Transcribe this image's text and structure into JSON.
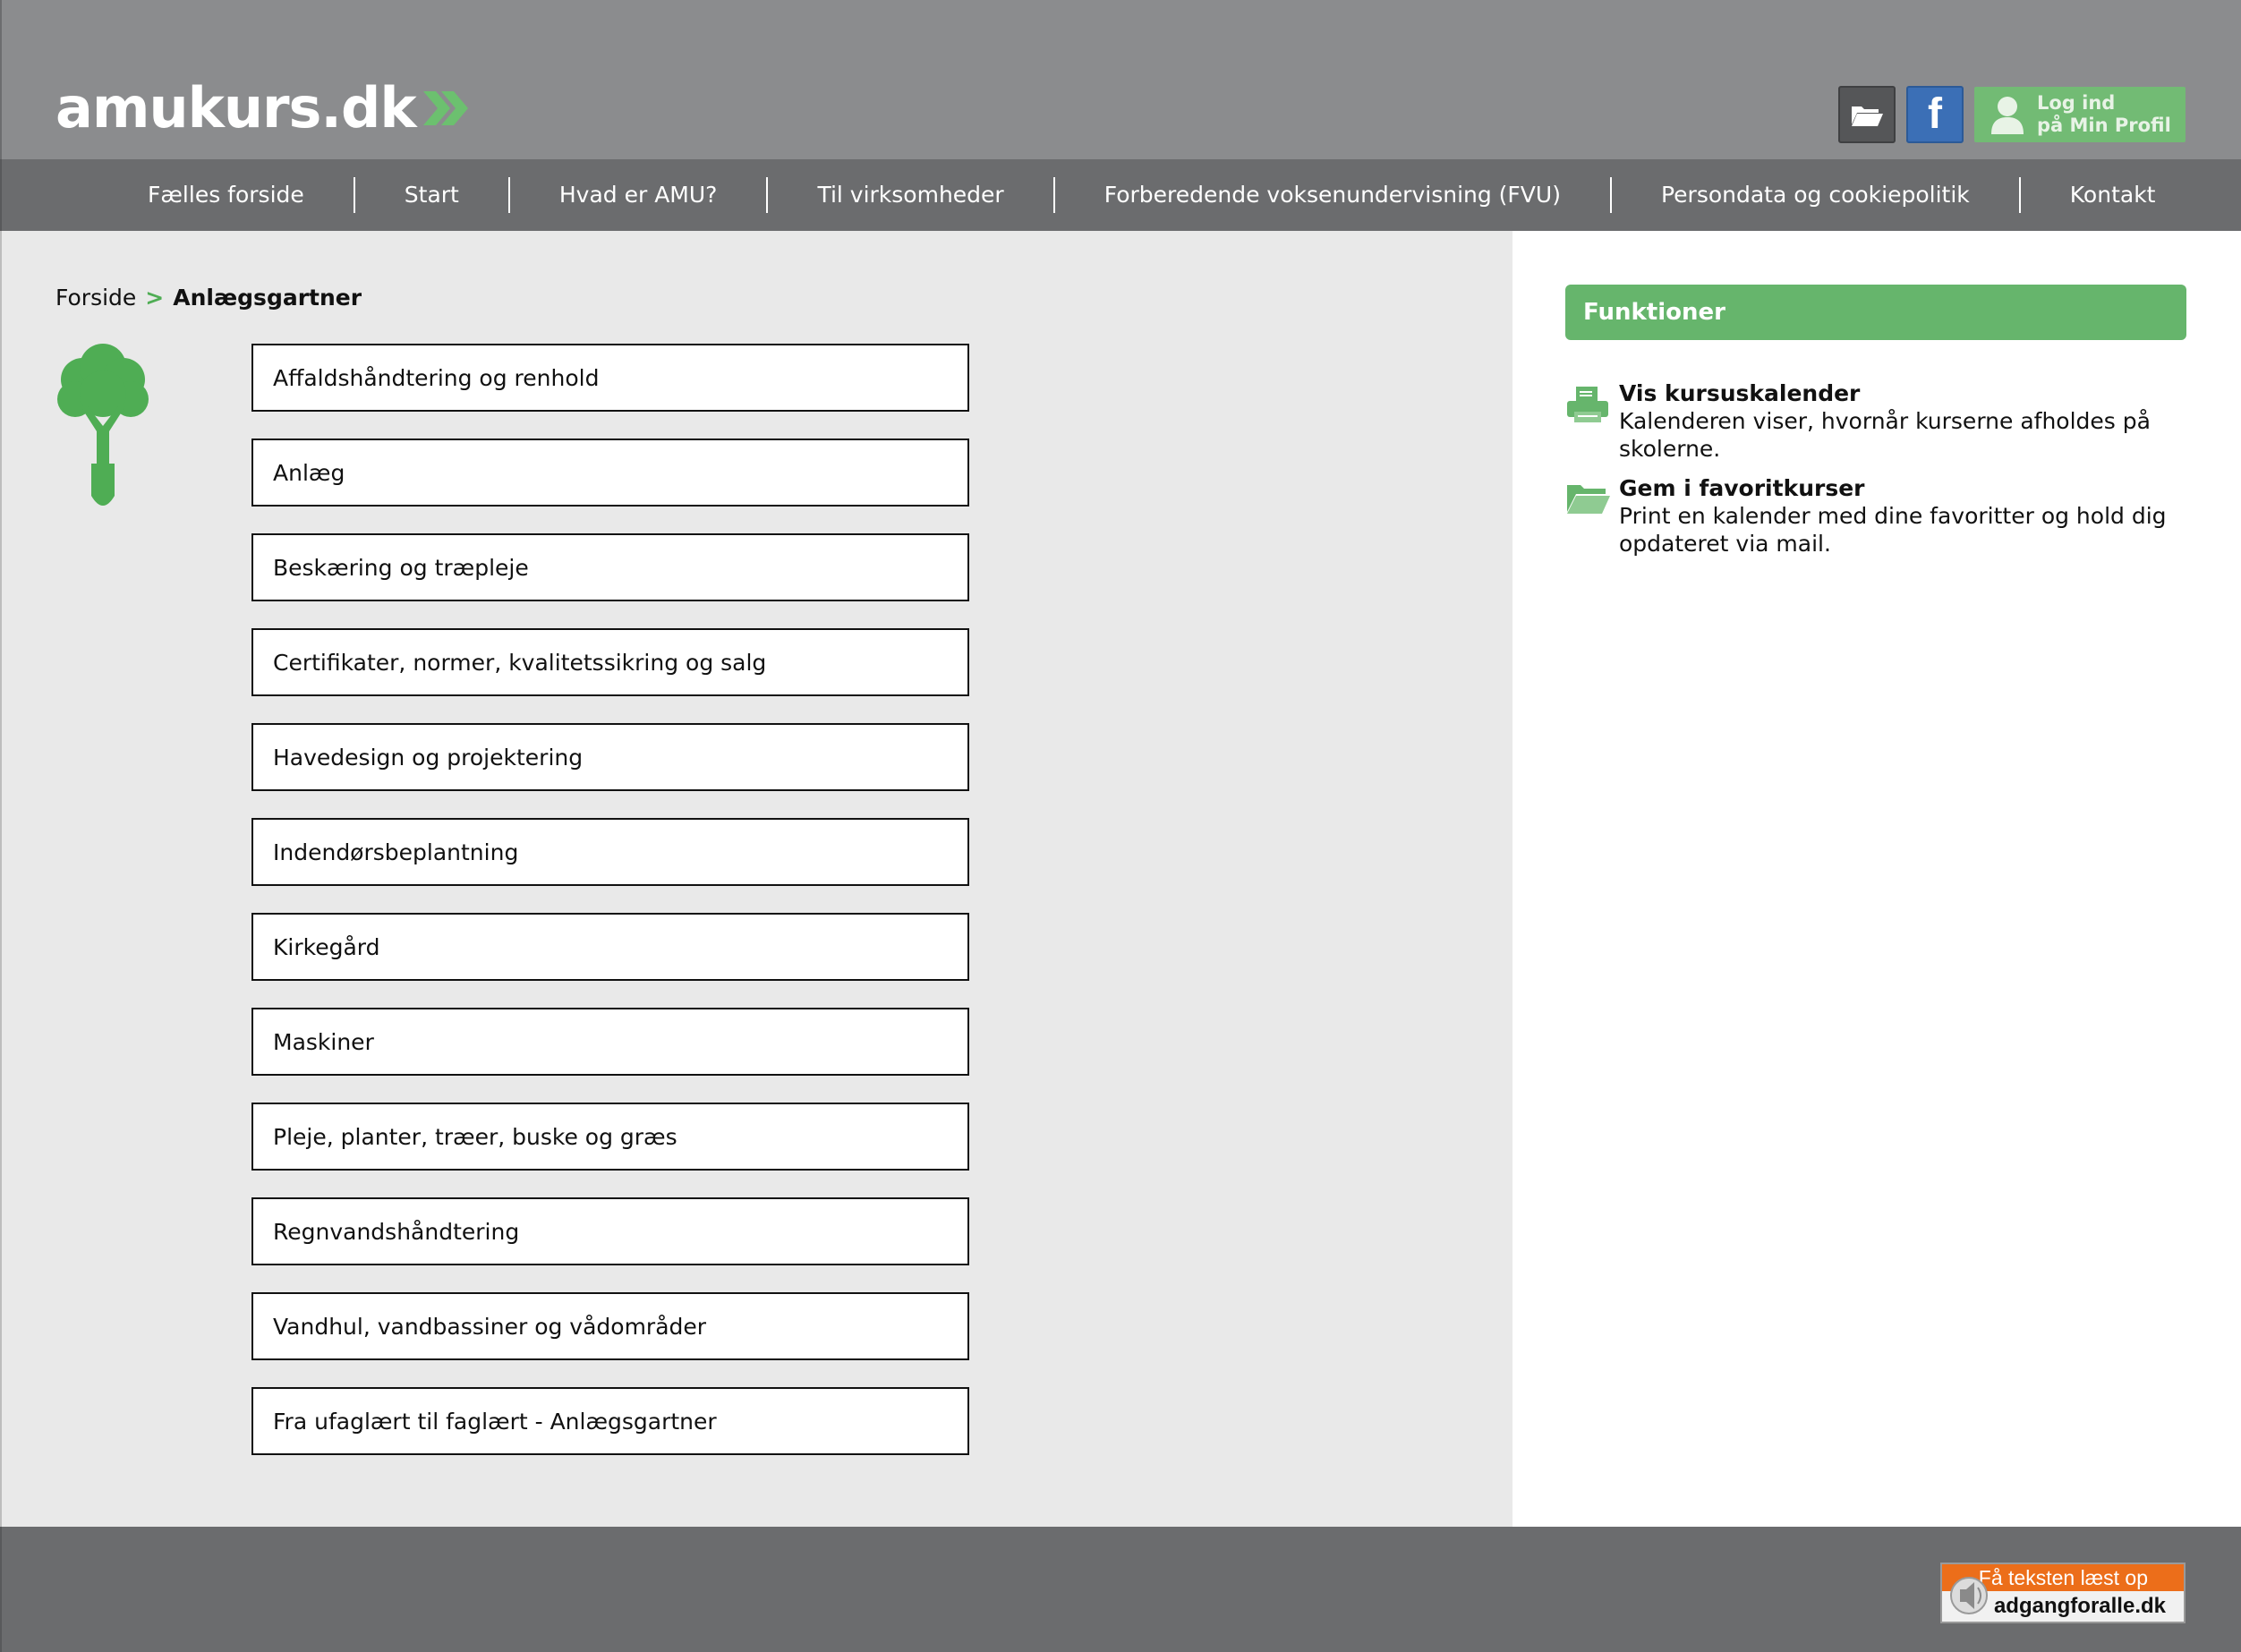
{
  "header": {
    "logo_text": "amukurs.dk",
    "icons": [
      "folder-icon",
      "facebook-icon",
      "user-icon"
    ],
    "login_line1": "Log ind",
    "login_line2": "på Min Profil",
    "facebook_letter": "f"
  },
  "nav": {
    "items": [
      "Fælles forside",
      "Start",
      "Hvad er AMU?",
      "Til virksomheder",
      "Forberedende voksenundervisning (FVU)",
      "Persondata og cookiepolitik",
      "Kontakt"
    ]
  },
  "breadcrumb": {
    "home": "Forside",
    "separator": ">",
    "current": "Anlægsgartner"
  },
  "categories": [
    "Affaldshåndtering og renhold",
    "Anlæg",
    "Beskæring og træpleje",
    "Certifikater, normer, kvalitetssikring og salg",
    "Havedesign og projektering",
    "Indendørsbeplantning",
    "Kirkegård",
    "Maskiner",
    "Pleje, planter, træer, buske og græs",
    "Regnvandshåndtering",
    "Vandhul, vandbassiner og vådområder",
    "Fra ufaglært til faglært - Anlægsgartner"
  ],
  "sidebar": {
    "title": "Funktioner",
    "functions": [
      {
        "icon": "printer-icon",
        "title": "Vis kursuskalender",
        "desc": "Kalenderen viser, hvornår kurserne afholdes på skolerne."
      },
      {
        "icon": "folder-icon",
        "title": "Gem i favoritkurser",
        "desc": "Print en kalender med dine favoritter og hold dig opdateret via mail."
      }
    ]
  },
  "footer": {
    "readspeaker_top": "Få teksten læst op",
    "readspeaker_bottom": "adgangforalle.dk"
  },
  "colors": {
    "accent_green": "#66b56c",
    "header_grey": "#8b8c8e",
    "nav_grey": "#6b6c6e"
  }
}
